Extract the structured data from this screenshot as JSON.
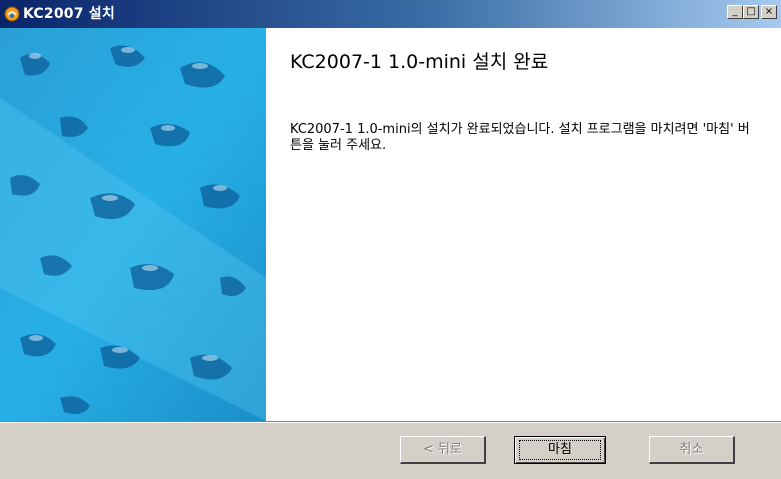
{
  "window": {
    "title": "KC2007 설치",
    "controls": {
      "minimize": "_",
      "maximize": "□",
      "close": "×"
    }
  },
  "page": {
    "heading": "KC2007-1 1.0-mini 설치 완료",
    "body": "KC2007-1 1.0-mini의 설치가 완료되었습니다. 설치 프로그램을 마치려면 '마침' 버튼을 눌러 주세요."
  },
  "buttons": {
    "back": "< 뒤로",
    "finish": "마침",
    "cancel": "취소"
  },
  "icons": {
    "app": "installer-app-icon",
    "sidebar": "water-texture-banner"
  },
  "colors": {
    "title_gradient_start": "#0a246a",
    "title_gradient_end": "#a6caf0",
    "panel_bg": "#ffffff",
    "chrome_bg": "#d4d0c8",
    "banner_blue": "#1ba3dc"
  }
}
